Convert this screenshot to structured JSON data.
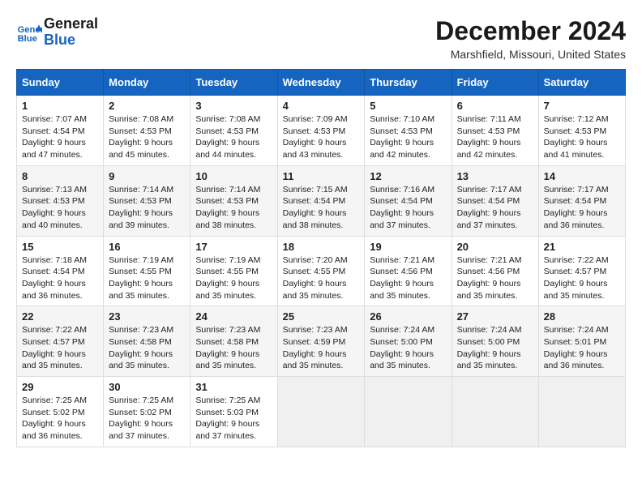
{
  "logo": {
    "line1": "General",
    "line2": "Blue"
  },
  "title": "December 2024",
  "subtitle": "Marshfield, Missouri, United States",
  "days_of_week": [
    "Sunday",
    "Monday",
    "Tuesday",
    "Wednesday",
    "Thursday",
    "Friday",
    "Saturday"
  ],
  "weeks": [
    [
      {
        "day": "1",
        "sunrise": "7:07 AM",
        "sunset": "4:54 PM",
        "daylight": "9 hours and 47 minutes."
      },
      {
        "day": "2",
        "sunrise": "7:08 AM",
        "sunset": "4:53 PM",
        "daylight": "9 hours and 45 minutes."
      },
      {
        "day": "3",
        "sunrise": "7:08 AM",
        "sunset": "4:53 PM",
        "daylight": "9 hours and 44 minutes."
      },
      {
        "day": "4",
        "sunrise": "7:09 AM",
        "sunset": "4:53 PM",
        "daylight": "9 hours and 43 minutes."
      },
      {
        "day": "5",
        "sunrise": "7:10 AM",
        "sunset": "4:53 PM",
        "daylight": "9 hours and 42 minutes."
      },
      {
        "day": "6",
        "sunrise": "7:11 AM",
        "sunset": "4:53 PM",
        "daylight": "9 hours and 42 minutes."
      },
      {
        "day": "7",
        "sunrise": "7:12 AM",
        "sunset": "4:53 PM",
        "daylight": "9 hours and 41 minutes."
      }
    ],
    [
      {
        "day": "8",
        "sunrise": "7:13 AM",
        "sunset": "4:53 PM",
        "daylight": "9 hours and 40 minutes."
      },
      {
        "day": "9",
        "sunrise": "7:14 AM",
        "sunset": "4:53 PM",
        "daylight": "9 hours and 39 minutes."
      },
      {
        "day": "10",
        "sunrise": "7:14 AM",
        "sunset": "4:53 PM",
        "daylight": "9 hours and 38 minutes."
      },
      {
        "day": "11",
        "sunrise": "7:15 AM",
        "sunset": "4:54 PM",
        "daylight": "9 hours and 38 minutes."
      },
      {
        "day": "12",
        "sunrise": "7:16 AM",
        "sunset": "4:54 PM",
        "daylight": "9 hours and 37 minutes."
      },
      {
        "day": "13",
        "sunrise": "7:17 AM",
        "sunset": "4:54 PM",
        "daylight": "9 hours and 37 minutes."
      },
      {
        "day": "14",
        "sunrise": "7:17 AM",
        "sunset": "4:54 PM",
        "daylight": "9 hours and 36 minutes."
      }
    ],
    [
      {
        "day": "15",
        "sunrise": "7:18 AM",
        "sunset": "4:54 PM",
        "daylight": "9 hours and 36 minutes."
      },
      {
        "day": "16",
        "sunrise": "7:19 AM",
        "sunset": "4:55 PM",
        "daylight": "9 hours and 35 minutes."
      },
      {
        "day": "17",
        "sunrise": "7:19 AM",
        "sunset": "4:55 PM",
        "daylight": "9 hours and 35 minutes."
      },
      {
        "day": "18",
        "sunrise": "7:20 AM",
        "sunset": "4:55 PM",
        "daylight": "9 hours and 35 minutes."
      },
      {
        "day": "19",
        "sunrise": "7:21 AM",
        "sunset": "4:56 PM",
        "daylight": "9 hours and 35 minutes."
      },
      {
        "day": "20",
        "sunrise": "7:21 AM",
        "sunset": "4:56 PM",
        "daylight": "9 hours and 35 minutes."
      },
      {
        "day": "21",
        "sunrise": "7:22 AM",
        "sunset": "4:57 PM",
        "daylight": "9 hours and 35 minutes."
      }
    ],
    [
      {
        "day": "22",
        "sunrise": "7:22 AM",
        "sunset": "4:57 PM",
        "daylight": "9 hours and 35 minutes."
      },
      {
        "day": "23",
        "sunrise": "7:23 AM",
        "sunset": "4:58 PM",
        "daylight": "9 hours and 35 minutes."
      },
      {
        "day": "24",
        "sunrise": "7:23 AM",
        "sunset": "4:58 PM",
        "daylight": "9 hours and 35 minutes."
      },
      {
        "day": "25",
        "sunrise": "7:23 AM",
        "sunset": "4:59 PM",
        "daylight": "9 hours and 35 minutes."
      },
      {
        "day": "26",
        "sunrise": "7:24 AM",
        "sunset": "5:00 PM",
        "daylight": "9 hours and 35 minutes."
      },
      {
        "day": "27",
        "sunrise": "7:24 AM",
        "sunset": "5:00 PM",
        "daylight": "9 hours and 35 minutes."
      },
      {
        "day": "28",
        "sunrise": "7:24 AM",
        "sunset": "5:01 PM",
        "daylight": "9 hours and 36 minutes."
      }
    ],
    [
      {
        "day": "29",
        "sunrise": "7:25 AM",
        "sunset": "5:02 PM",
        "daylight": "9 hours and 36 minutes."
      },
      {
        "day": "30",
        "sunrise": "7:25 AM",
        "sunset": "5:02 PM",
        "daylight": "9 hours and 37 minutes."
      },
      {
        "day": "31",
        "sunrise": "7:25 AM",
        "sunset": "5:03 PM",
        "daylight": "9 hours and 37 minutes."
      },
      null,
      null,
      null,
      null
    ]
  ],
  "labels": {
    "sunrise": "Sunrise: ",
    "sunset": "Sunset: ",
    "daylight": "Daylight: "
  }
}
